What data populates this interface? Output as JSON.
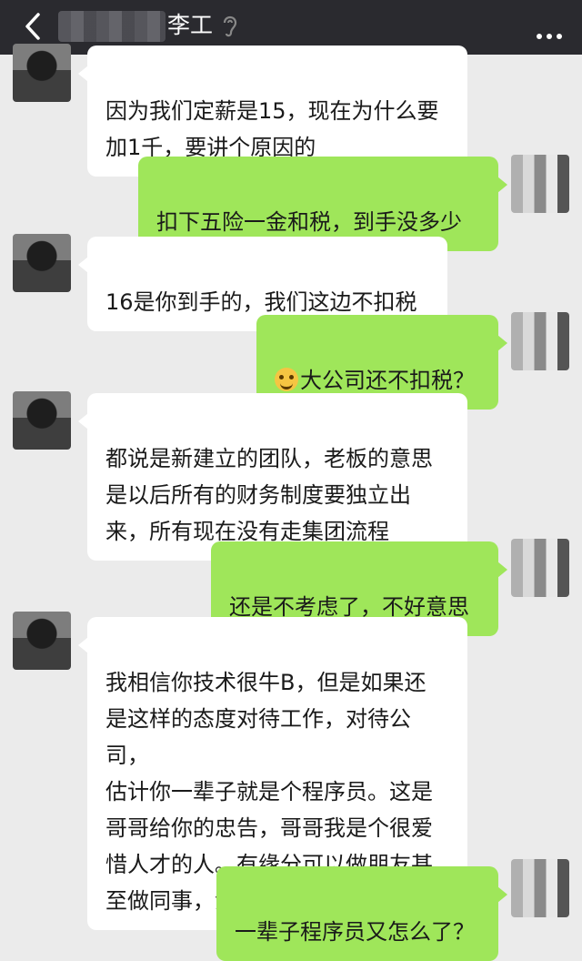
{
  "header": {
    "back_label": "<",
    "title": "李工",
    "more_label": "more"
  },
  "messages": [
    {
      "side": "left",
      "text": "因为我们定薪是15，现在为什么要\n加1千，要讲个原因的"
    },
    {
      "side": "right",
      "text": "扣下五险一金和税，到手没多少"
    },
    {
      "side": "left",
      "text": "16是你到手的，我们这边不扣税"
    },
    {
      "side": "right",
      "text": "大公司还不扣税？",
      "emoji": "flushed-face-emoji"
    },
    {
      "side": "left",
      "text": "都说是新建立的团队，老板的意思\n是以后所有的财务制度要独立出\n来，所有现在没有走集团流程"
    },
    {
      "side": "right",
      "text": "还是不考虑了，不好意思"
    },
    {
      "side": "left",
      "text": "我相信你技术很牛B，但是如果还\n是这样的态度对待工作，对待公司，\n估计你一辈子就是个程序员。这是\n哥哥给你的忠告，哥哥我是个很爱\n惜人才的人。有缘分可以做朋友甚\n至做同事，没缘分，可以互删",
      "emoji": "grin-emoji"
    },
    {
      "side": "right",
      "text": "一辈子程序员又怎么了？"
    }
  ]
}
